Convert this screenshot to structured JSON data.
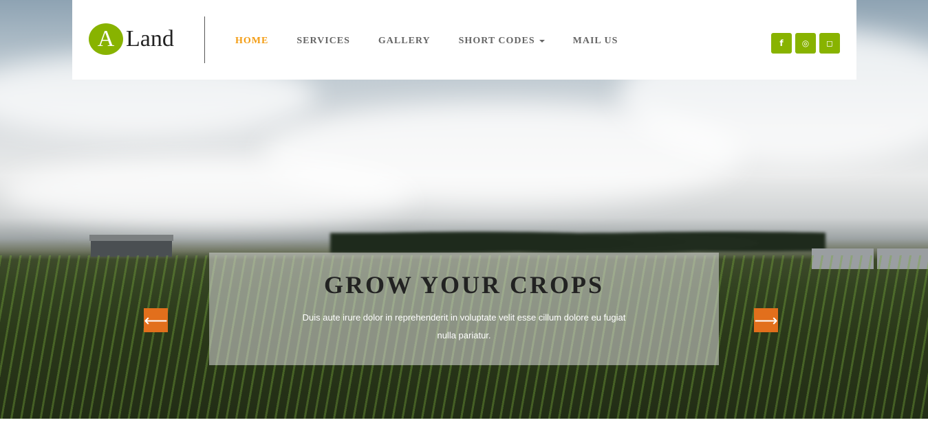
{
  "logo": {
    "letter": "A",
    "text": "Land"
  },
  "nav": {
    "items": [
      {
        "label": "HOME",
        "active": true
      },
      {
        "label": "SERVICES",
        "active": false
      },
      {
        "label": "GALLERY",
        "active": false
      },
      {
        "label": "SHORT CODES",
        "active": false,
        "dropdown": true
      },
      {
        "label": "MAIL US",
        "active": false
      }
    ]
  },
  "social": [
    {
      "name": "facebook-icon",
      "glyph": "f"
    },
    {
      "name": "dribbble-icon",
      "glyph": "◎"
    },
    {
      "name": "instagram-icon",
      "glyph": "◻"
    }
  ],
  "slider": {
    "title": "GROW YOUR CROPS",
    "text": "Duis aute irure dolor in reprehenderit in voluptate velit esse cillum dolore eu fugiat nulla pariatur.",
    "prev_glyph": "⟵",
    "next_glyph": "⟶"
  },
  "colors": {
    "brand_green": "#88b300",
    "active_orange": "#f39c12",
    "arrow_orange": "#e26f1c"
  }
}
